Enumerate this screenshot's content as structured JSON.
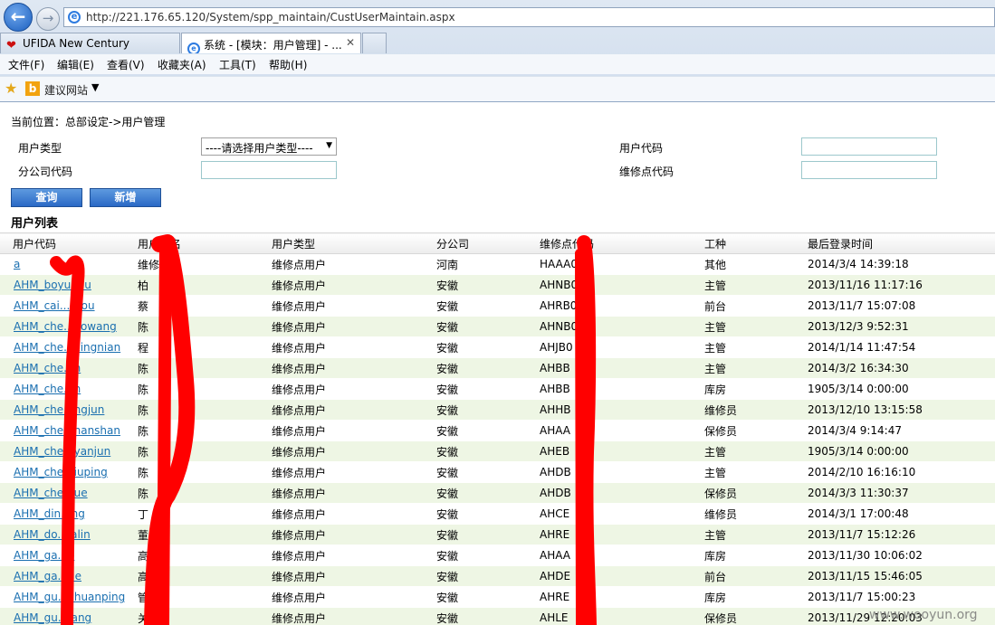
{
  "browser": {
    "url": "http://221.176.65.120/System/spp_maintain/CustUserMaintain.aspx",
    "tabs": [
      {
        "label": "UFIDA New Century"
      },
      {
        "label": "系统 - [模块：用户管理] - ..."
      }
    ],
    "menu": [
      "文件(F)",
      "编辑(E)",
      "查看(V)",
      "收藏夹(A)",
      "工具(T)",
      "帮助(H)"
    ],
    "favorites_label": "建议网站"
  },
  "page": {
    "breadcrumb": "当前位置：总部设定->用户管理",
    "filters": {
      "user_type_label": "用户类型",
      "user_type_value": "----请选择用户类型----",
      "branch_code_label": "分公司代码",
      "user_code_label": "用户代码",
      "repair_code_label": "维修点代码"
    },
    "buttons": {
      "query": "查询",
      "add": "新增"
    },
    "list_title": "用户列表",
    "columns": [
      "用户代码",
      "用户姓名",
      "用户类型",
      "分公司",
      "维修点代码",
      "工种",
      "最后登录时间"
    ],
    "rows": [
      {
        "code": "a",
        "name": "维修点",
        "type": "维修点用户",
        "branch": "河南",
        "repair_code": "HAAA0",
        "job": "其他",
        "last_login": "2014/3/4 14:39:18"
      },
      {
        "code": "AHM_boyu..ou",
        "name": "柏",
        "type": "维修点用户",
        "branch": "安徽",
        "repair_code": "AHNB0",
        "job": "主管",
        "last_login": "2013/11/16 11:17:16"
      },
      {
        "code": "AHM_cai...grou",
        "name": "蔡",
        "type": "维修点用户",
        "branch": "安徽",
        "repair_code": "AHRB0",
        "job": "前台",
        "last_login": "2013/11/7 15:07:08"
      },
      {
        "code": "AHM_che...aowang",
        "name": "陈",
        "type": "维修点用户",
        "branch": "安徽",
        "repair_code": "AHNB0",
        "job": "主管",
        "last_login": "2013/12/3 9:52:31"
      },
      {
        "code": "AHM_che...xingnian",
        "name": "程",
        "type": "维修点用户",
        "branch": "安徽",
        "repair_code": "AHJB0",
        "job": "主管",
        "last_login": "2014/1/14 11:47:54"
      },
      {
        "code": "AHM_che...n",
        "name": "陈",
        "type": "维修点用户",
        "branch": "安徽",
        "repair_code": "AHBB",
        "job": "主管",
        "last_login": "2014/3/2 16:34:30"
      },
      {
        "code": "AHM_che...n",
        "name": "陈",
        "type": "维修点用户",
        "branch": "安徽",
        "repair_code": "AHBB",
        "job": "库房",
        "last_login": "1905/3/14 0:00:00"
      },
      {
        "code": "AHM_che...ngjun",
        "name": "陈",
        "type": "维修点用户",
        "branch": "安徽",
        "repair_code": "AHHB",
        "job": "维修员",
        "last_login": "2013/12/10 13:15:58"
      },
      {
        "code": "AHM_che...nanshan",
        "name": "陈",
        "type": "维修点用户",
        "branch": "安徽",
        "repair_code": "AHAA",
        "job": "保修员",
        "last_login": "2014/3/4 9:14:47"
      },
      {
        "code": "AHM_che...yanjun",
        "name": "陈",
        "type": "维修点用户",
        "branch": "安徽",
        "repair_code": "AHEB",
        "job": "主管",
        "last_login": "1905/3/14 0:00:00"
      },
      {
        "code": "AHM_che...iuping",
        "name": "陈",
        "type": "维修点用户",
        "branch": "安徽",
        "repair_code": "AHDB",
        "job": "主管",
        "last_login": "2014/2/10 16:16:10"
      },
      {
        "code": "AHM_che...ue",
        "name": "陈",
        "type": "维修点用户",
        "branch": "安徽",
        "repair_code": "AHDB",
        "job": "保修员",
        "last_login": "2014/3/3 11:30:37"
      },
      {
        "code": "AHM_din...ng",
        "name": "丁",
        "type": "维修点用户",
        "branch": "安徽",
        "repair_code": "AHCE",
        "job": "维修员",
        "last_login": "2014/3/1 17:00:48"
      },
      {
        "code": "AHM_do...ialin",
        "name": "董",
        "type": "维修点用户",
        "branch": "安徽",
        "repair_code": "AHRE",
        "job": "主管",
        "last_login": "2013/11/7 15:12:26"
      },
      {
        "code": "AHM_ga...o",
        "name": "高",
        "type": "维修点用户",
        "branch": "安徽",
        "repair_code": "AHAA",
        "job": "库房",
        "last_login": "2013/11/30 10:06:02"
      },
      {
        "code": "AHM_ga...ue",
        "name": "高",
        "type": "维修点用户",
        "branch": "安徽",
        "repair_code": "AHDE",
        "job": "前台",
        "last_login": "2013/11/15 15:46:05"
      },
      {
        "code": "AHM_gu...chuanping",
        "name": "管...平",
        "type": "维修点用户",
        "branch": "安徽",
        "repair_code": "AHRE",
        "job": "库房",
        "last_login": "2013/11/7 15:00:23"
      },
      {
        "code": "AHM_gu...iang",
        "name": "关",
        "type": "维修点用户",
        "branch": "安徽",
        "repair_code": "AHLE",
        "job": "保修员",
        "last_login": "2013/11/29 12:20:03"
      }
    ]
  },
  "watermark": "www.wooyun.org",
  "colors": {
    "accent": "#2a69c6",
    "row_alt": "#eef6e4",
    "link": "#1a6fb0",
    "redaction": "#ff0000"
  }
}
